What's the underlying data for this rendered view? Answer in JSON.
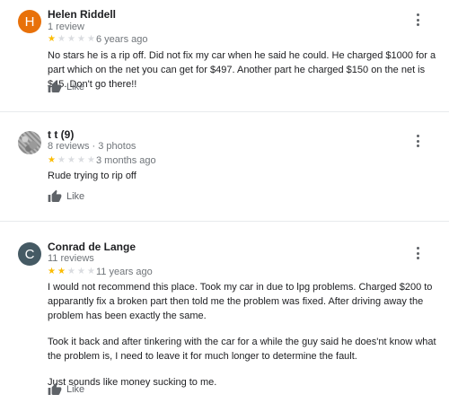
{
  "reviews": [
    {
      "avatar_letter": "H",
      "avatar_color": "#e8710a",
      "name": "Helen Riddell",
      "meta": "1 review",
      "rating": 1,
      "age": "6 years ago",
      "paragraphs": [
        "No stars he is a rip off. Did not fix my car when he said he could. He charged $1000 for a part which on the net you can get for $497. Another part he charged $150 on the net is $45. Don't go there!!"
      ],
      "like_label": "Like"
    },
    {
      "avatar_letter": "",
      "avatar_icon": "photo-avatar",
      "name": "t t (9)",
      "meta": "8 reviews · 3 photos",
      "rating": 1,
      "age": "3 months ago",
      "paragraphs": [
        "Rude trying to rip off"
      ],
      "like_label": "Like"
    },
    {
      "avatar_letter": "C",
      "avatar_color": "#455a64",
      "name": "Conrad de Lange",
      "meta": "11 reviews",
      "rating": 2,
      "age": "11 years ago",
      "paragraphs": [
        "I would not recommend this place. Took my car in due to lpg problems. Charged $200 to apparantly fix a broken part then told me the problem was fixed. After driving away the problem has been exactly the same.",
        "Took it back and after tinkering with the car for a while the guy said he does'nt know what the problem is, I need to leave it for much longer to determine the fault.",
        "Just sounds like money sucking to me."
      ],
      "like_label": "Like"
    }
  ],
  "colors": {
    "star_filled": "#fbbc04",
    "star_empty": "#dadce0",
    "muted_text": "#70757a",
    "divider": "#e8eaed"
  },
  "max_rating": 5
}
